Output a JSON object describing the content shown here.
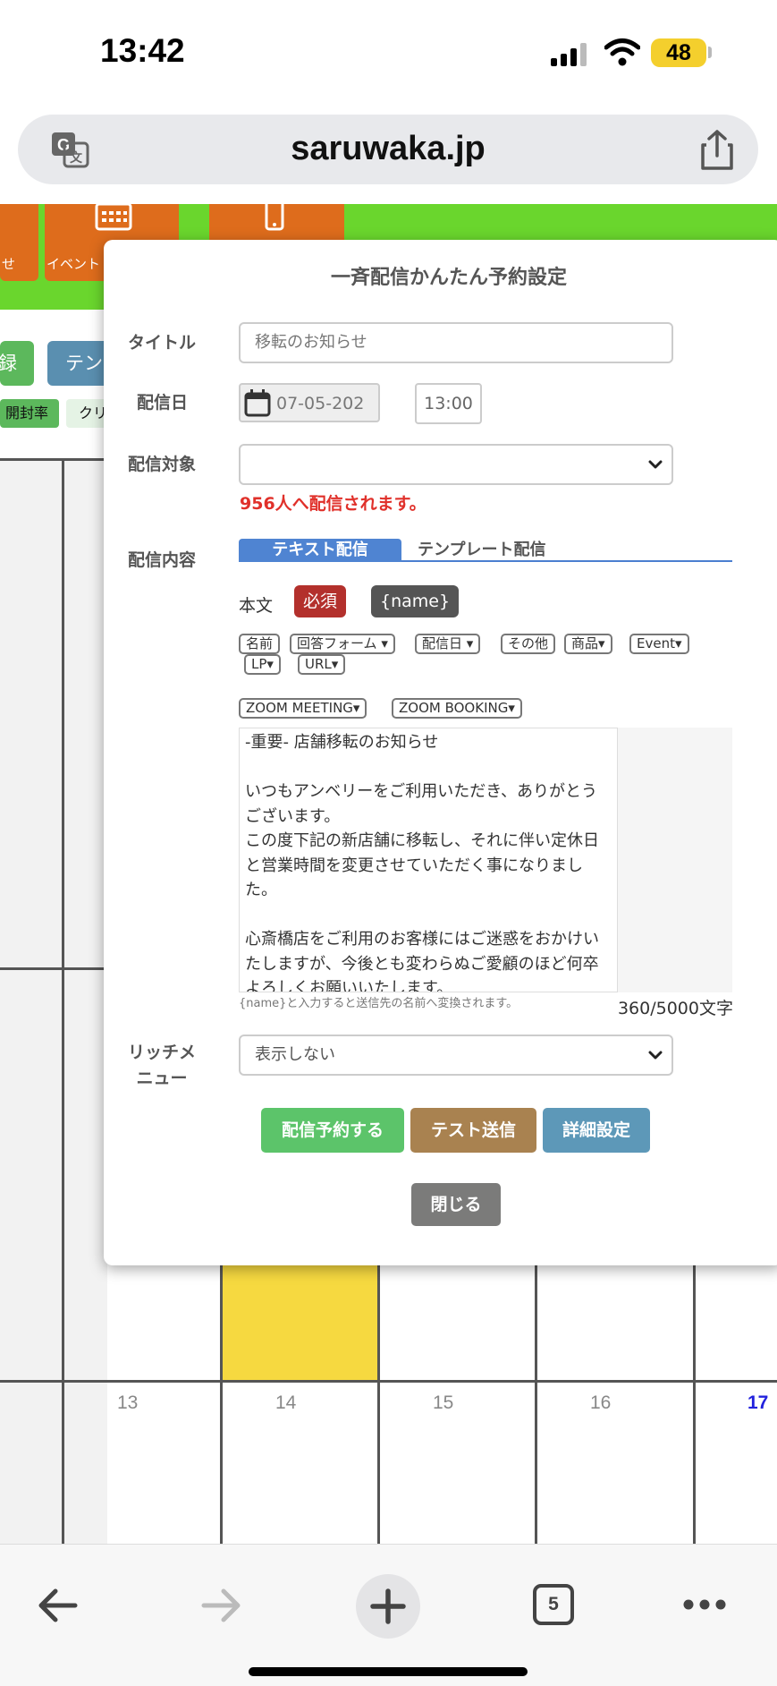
{
  "status_bar": {
    "time": "13:42",
    "battery": "48"
  },
  "browser": {
    "url": "saruwaka.jp",
    "tab_count": "5"
  },
  "background_page": {
    "tiles": [
      {
        "label": "せ"
      },
      {
        "label": "イベント"
      }
    ],
    "buttons": [
      {
        "label": "録",
        "color": "#5cb85c"
      },
      {
        "label": "テン",
        "color": "#5a8fb0"
      }
    ],
    "pills": [
      {
        "label": "開封率"
      },
      {
        "label": "クリ"
      }
    ],
    "calendar_days": [
      "13",
      "14",
      "15",
      "16",
      "17"
    ]
  },
  "modal": {
    "title": "一斉配信かんたん予約設定",
    "fields": {
      "title_label": "タイトル",
      "title_placeholder": "移転のお知らせ",
      "date_label": "配信日",
      "date_value": "07-05-202",
      "time_value": "13:00",
      "target_label": "配信対象",
      "target_value": "",
      "recipient_notice": "956人へ配信されます。",
      "content_label": "配信内容",
      "rich_menu_label": "リッチメ\nニュー",
      "rich_menu_value": "表示しない"
    },
    "tabs": {
      "text": "テキスト配信",
      "template": "テンプレート配信"
    },
    "body": {
      "label": "本文",
      "required_badge": "必須",
      "name_badge": "{name}",
      "insert_buttons_row1": [
        "名前",
        "回答フォーム ▾",
        "配信日 ▾",
        "その他",
        "商品▾",
        "Event▾"
      ],
      "insert_buttons_row2": [
        "LP▾",
        "URL▾"
      ],
      "insert_buttons_row3": [
        "ZOOM MEETING▾",
        "ZOOM BOOKING▾"
      ],
      "message": "-重要- 店舗移転のお知らせ\n\nいつもアンベリーをご利用いただき、ありがとうございます。\nこの度下記の新店舗に移転し、それに伴い定休日と営業時間を変更させていただく事になりました。\n\n心斎橋店をご利用のお客様にはご迷惑をおかけいたしますが、今後とも変わらぬご愛顧のほど何卒よろしくお願いいたします。",
      "hint": "{name}と入力すると送信先の名前へ変換されます。",
      "char_count": "360/5000文字"
    },
    "actions": {
      "schedule": "配信予約する",
      "test_send": "テスト送信",
      "details": "詳細設定",
      "close": "閉じる"
    },
    "colors": {
      "schedule": "#5cc46a",
      "test_send": "#a98250",
      "details": "#5d98b8",
      "close": "#7b7b7a",
      "required": "#b3302c",
      "name_badge": "#555555",
      "notice": "#e0302a",
      "tab_active": "#4f84d2"
    }
  },
  "toolbar": {
    "icons": [
      "back-arrow-icon",
      "forward-arrow-icon",
      "new-tab-plus-icon",
      "tabs-icon",
      "more-icon"
    ]
  }
}
